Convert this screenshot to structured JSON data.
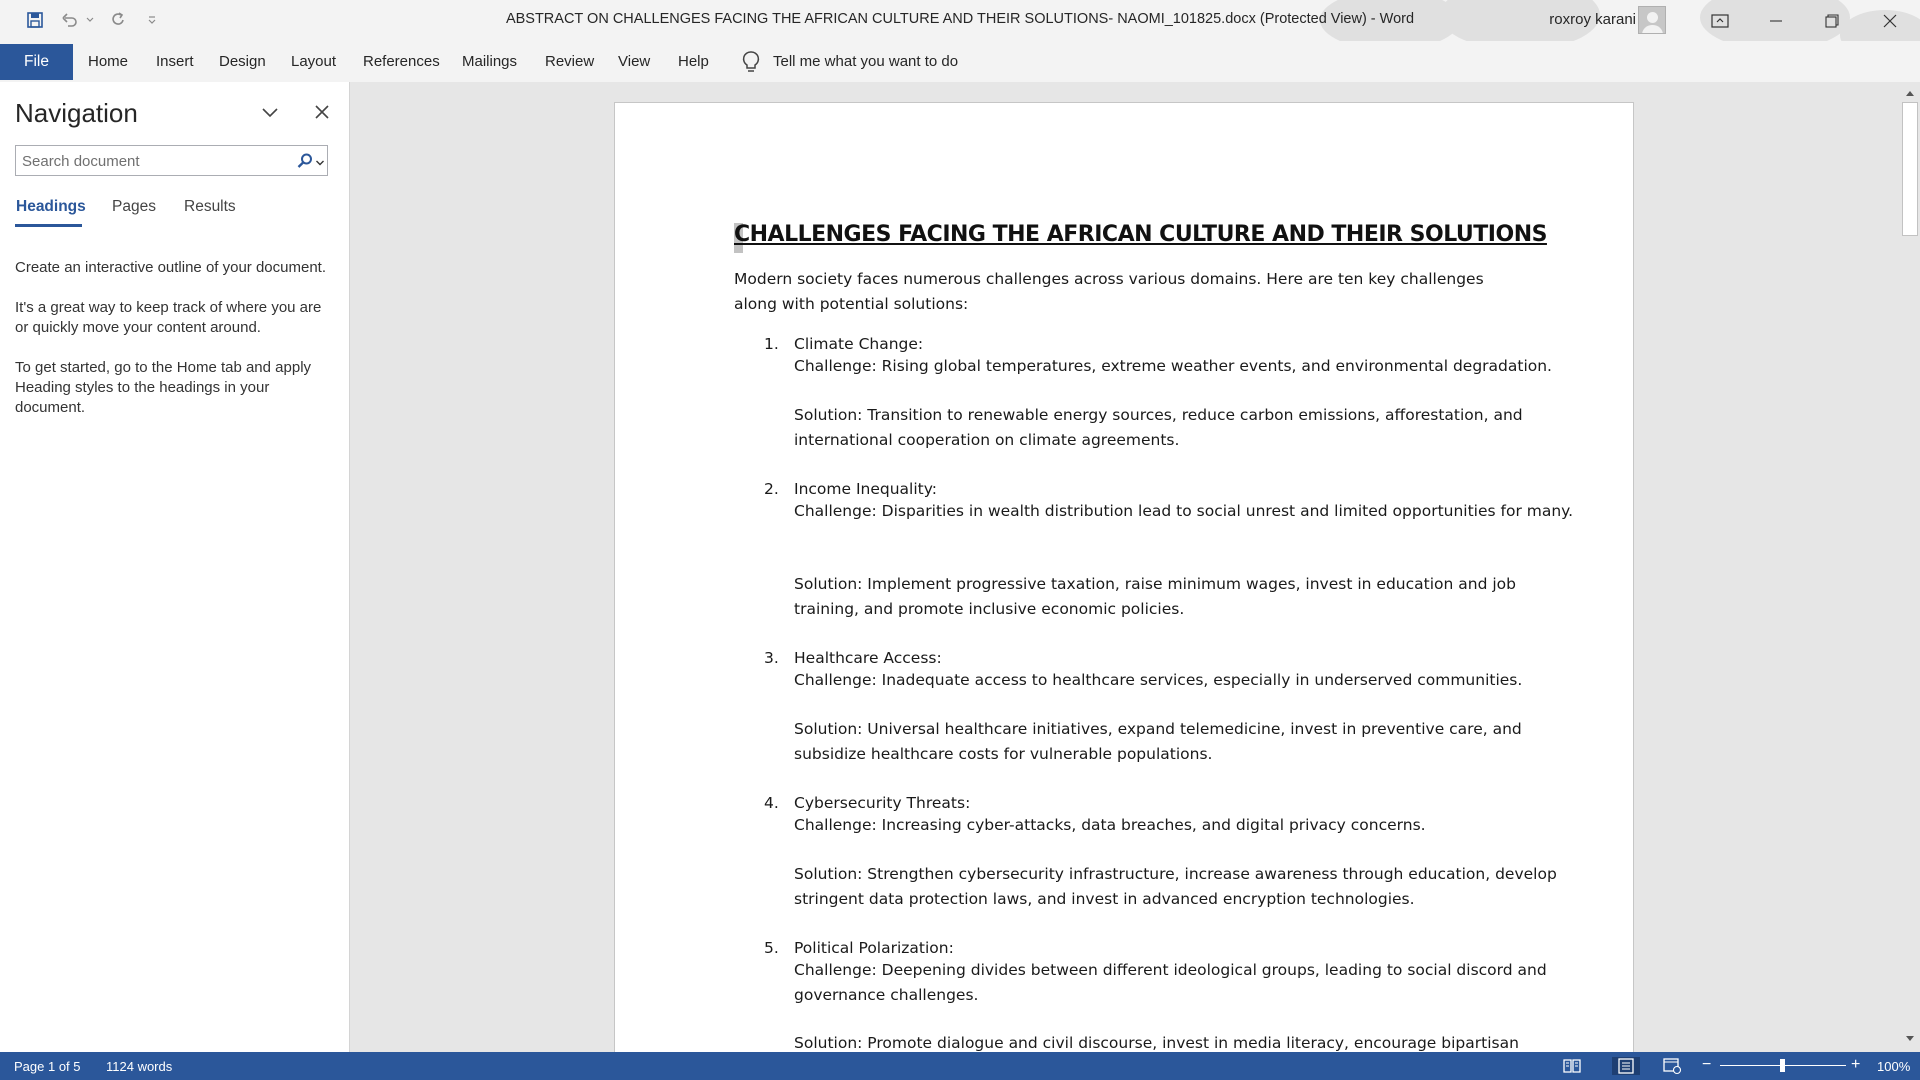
{
  "window": {
    "title": "ABSTRACT ON CHALLENGES FACING THE AFRICAN CULTURE AND THEIR SOLUTIONS- NAOMI_101825.docx (Protected View)  -  Word",
    "user": "roxroy karani"
  },
  "ribbon": {
    "file": "File",
    "tabs": [
      "Home",
      "Insert",
      "Design",
      "Layout",
      "References",
      "Mailings",
      "Review",
      "View",
      "Help"
    ],
    "tell_me": "Tell me what you want to do"
  },
  "navigation": {
    "title": "Navigation",
    "search_placeholder": "Search document",
    "tabs": [
      "Headings",
      "Pages",
      "Results"
    ],
    "active_tab": "Headings",
    "help": [
      "Create an interactive outline of your document.",
      "It's a great way to keep track of where you are or quickly move your content around.",
      "To get started, go to the Home tab and apply Heading styles to the headings in your document."
    ]
  },
  "document": {
    "title": "CHALLENGES FACING THE AFRICAN CULTURE AND THEIR SOLUTIONS",
    "intro": "Modern society faces numerous challenges across various domains. Here are ten key challenges along with potential solutions:",
    "items": [
      {
        "num": "1.",
        "heading": "Climate Change:",
        "challenge": "Challenge: Rising global temperatures, extreme weather events, and environmental degradation.",
        "solution": "Solution: Transition to renewable energy sources, reduce carbon emissions, afforestation, and international cooperation on climate agreements."
      },
      {
        "num": "2.",
        "heading": "Income Inequality:",
        "challenge": "Challenge: Disparities in wealth distribution lead to social unrest and limited opportunities for many.",
        "solution": "Solution: Implement progressive taxation, raise minimum wages, invest in education and job training, and promote inclusive economic policies."
      },
      {
        "num": "3.",
        "heading": "Healthcare Access:",
        "challenge": "Challenge: Inadequate access to healthcare services, especially in underserved communities.",
        "solution": "Solution: Universal healthcare initiatives, expand telemedicine, invest in preventive care, and subsidize healthcare costs for vulnerable populations."
      },
      {
        "num": "4.",
        "heading": "Cybersecurity Threats:",
        "challenge": "Challenge: Increasing cyber-attacks, data breaches, and digital privacy concerns.",
        "solution": "Solution: Strengthen cybersecurity infrastructure, increase awareness through education, develop stringent data protection laws, and invest in advanced encryption technologies."
      },
      {
        "num": "5.",
        "heading": "Political Polarization:",
        "challenge": "Challenge: Deepening divides between different ideological groups, leading to social discord and governance challenges.",
        "solution": "Solution: Promote dialogue and civil discourse, invest in media literacy, encourage bipartisan"
      }
    ]
  },
  "status": {
    "page": "Page 1 of 5",
    "words": "1124 words",
    "zoom": "100%",
    "minus": "−",
    "plus": "+"
  },
  "colors": {
    "accent": "#2b579a",
    "chrome": "#f3f3f3",
    "canvas": "#e6e6e6"
  },
  "icons": [
    "save-icon",
    "undo-icon",
    "redo-icon",
    "customize-icon",
    "lightbulb-icon",
    "search-icon",
    "close-icon",
    "chevron-down-icon",
    "read-mode-icon",
    "print-layout-icon",
    "web-layout-icon"
  ]
}
